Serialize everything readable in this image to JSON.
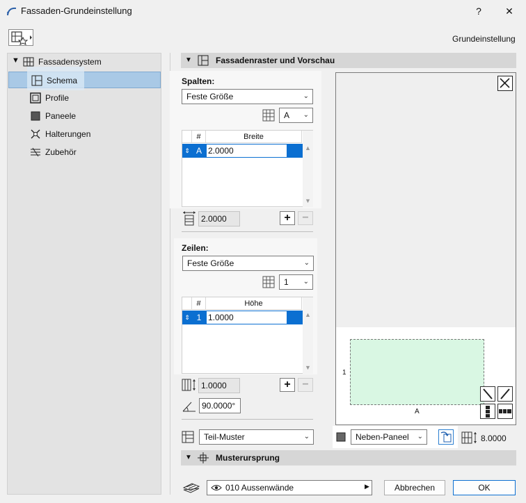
{
  "window": {
    "title": "Fassaden-Grundeinstellung",
    "help": "?",
    "close": "✕"
  },
  "header": {
    "right_label": "Grundeinstellung"
  },
  "sidebar": {
    "root": "Fassadensystem",
    "items": [
      {
        "label": "Schema"
      },
      {
        "label": "Profile"
      },
      {
        "label": "Paneele"
      },
      {
        "label": "Halterungen"
      },
      {
        "label": "Zubehör"
      }
    ]
  },
  "section1": {
    "title": "Fassadenraster und Vorschau"
  },
  "columns": {
    "heading": "Spalten:",
    "mode": "Feste Größe",
    "pattern": "A",
    "table": {
      "col_num": "#",
      "col_width": "Breite",
      "rows": [
        {
          "id": "A",
          "value": "2.0000"
        }
      ]
    },
    "total": "2.0000",
    "add": "+",
    "remove": "−"
  },
  "rows": {
    "heading": "Zeilen:",
    "mode": "Feste Größe",
    "pattern": "1",
    "table": {
      "col_num": "#",
      "col_height": "Höhe",
      "rows": [
        {
          "id": "1",
          "value": "1.0000"
        }
      ]
    },
    "total": "1.0000",
    "angle": "90.0000°",
    "add": "+",
    "remove": "−"
  },
  "pattern_dropdown": "Teil-Muster",
  "preview": {
    "row_label": "1",
    "col_label": "A",
    "panel_dropdown": "Neben-Paneel",
    "size_value": "8.0000",
    "colors": {
      "panel_fill": "#d9f7e3",
      "panel_border": "#777777"
    }
  },
  "section2": {
    "title": "Musterursprung"
  },
  "footer": {
    "layer": "010 Aussenwände",
    "cancel": "Abbrechen",
    "ok": "OK"
  },
  "colors": {
    "accent": "#0b6fd1",
    "selected_row": "#a9c9e6"
  }
}
